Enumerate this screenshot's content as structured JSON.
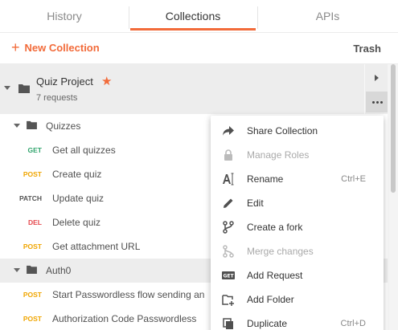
{
  "tabs": [
    {
      "label": "History",
      "active": false
    },
    {
      "label": "Collections",
      "active": true
    },
    {
      "label": "APIs",
      "active": false
    }
  ],
  "toolbar": {
    "new_collection": "New Collection",
    "trash": "Trash"
  },
  "collection": {
    "name": "Quiz Project",
    "requests": "7 requests",
    "starred": true
  },
  "tree": {
    "folder1": "Quizzes",
    "folder2": "Auth0",
    "requests": [
      {
        "method": "GET",
        "name": "Get all quizzes",
        "color": "#2fa36b"
      },
      {
        "method": "POST",
        "name": "Create quiz",
        "color": "#f0a500"
      },
      {
        "method": "PATCH",
        "name": "Update quiz",
        "color": "#555555"
      },
      {
        "method": "DEL",
        "name": "Delete quiz",
        "color": "#e5484d"
      },
      {
        "method": "POST",
        "name": "Get attachment URL",
        "color": "#f0a500"
      },
      {
        "method": "POST",
        "name": "Start Passwordless flow sending an",
        "color": "#f0a500"
      },
      {
        "method": "POST",
        "name": "Authorization Code Passwordless",
        "color": "#f0a500"
      }
    ]
  },
  "menu": {
    "items": [
      {
        "label": "Share Collection",
        "shortcut": "",
        "enabled": true,
        "icon": "share-icon"
      },
      {
        "label": "Manage Roles",
        "shortcut": "",
        "enabled": false,
        "icon": "lock-icon"
      },
      {
        "label": "Rename",
        "shortcut": "Ctrl+E",
        "enabled": true,
        "icon": "rename-icon"
      },
      {
        "label": "Edit",
        "shortcut": "",
        "enabled": true,
        "icon": "pencil-icon"
      },
      {
        "label": "Create a fork",
        "shortcut": "",
        "enabled": true,
        "icon": "fork-icon"
      },
      {
        "label": "Merge changes",
        "shortcut": "",
        "enabled": false,
        "icon": "merge-icon"
      },
      {
        "label": "Add Request",
        "shortcut": "",
        "enabled": true,
        "icon": "request-icon"
      },
      {
        "label": "Add Folder",
        "shortcut": "",
        "enabled": true,
        "icon": "add-folder-icon"
      },
      {
        "label": "Duplicate",
        "shortcut": "Ctrl+D",
        "enabled": true,
        "icon": "duplicate-icon"
      }
    ]
  },
  "colors": {
    "accent": "#f26b3a",
    "get": "#2fa36b",
    "post": "#f0a500",
    "delete": "#e5484d"
  }
}
